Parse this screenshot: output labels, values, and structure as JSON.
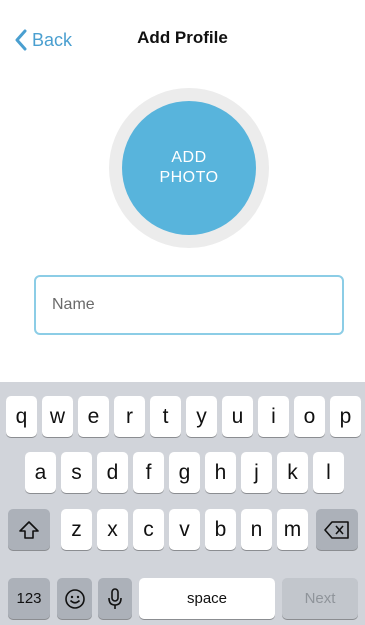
{
  "nav": {
    "back_label": "Back",
    "title": "Add Profile"
  },
  "photo": {
    "label": "ADD PHOTO"
  },
  "name_field": {
    "placeholder": "Name",
    "value": ""
  },
  "keyboard": {
    "row1": [
      "q",
      "w",
      "e",
      "r",
      "t",
      "y",
      "u",
      "i",
      "o",
      "p"
    ],
    "row2": [
      "a",
      "s",
      "d",
      "f",
      "g",
      "h",
      "j",
      "k",
      "l"
    ],
    "row3": [
      "z",
      "x",
      "c",
      "v",
      "b",
      "n",
      "m"
    ],
    "numbers_label": "123",
    "space_label": "space",
    "next_label": "Next"
  },
  "colors": {
    "accent": "#4a9fd0",
    "photo_button": "#58b4dc",
    "keyboard_bg": "#d1d4da"
  },
  "icons": {
    "back": "chevron-left-icon",
    "shift": "shift-icon",
    "delete": "backspace-icon",
    "emoji": "emoji-icon",
    "mic": "microphone-icon"
  }
}
